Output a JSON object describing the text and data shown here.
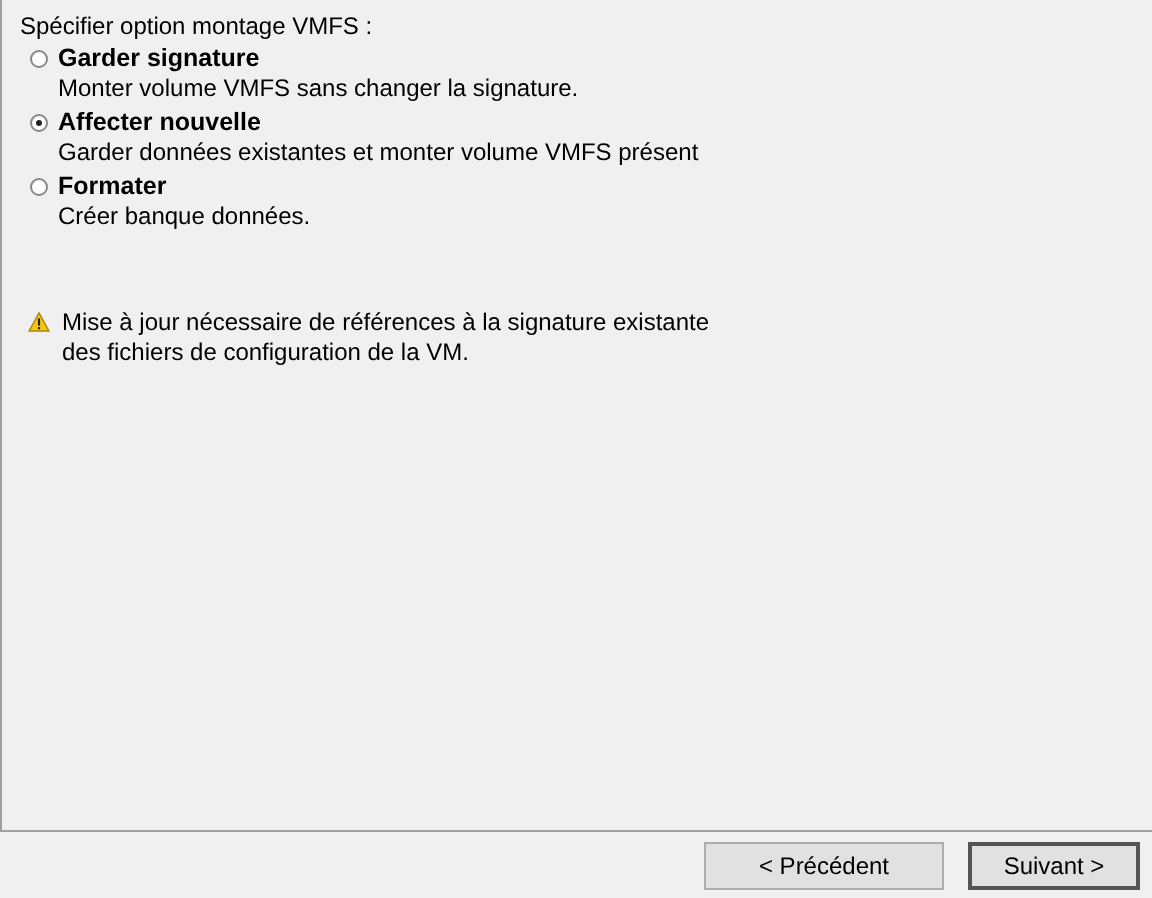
{
  "prompt": "Spécifier option montage VMFS :",
  "options": [
    {
      "label": "Garder signature",
      "description": "Monter volume VMFS sans changer la signature.",
      "selected": false
    },
    {
      "label": "Affecter nouvelle",
      "description": "Garder données existantes et monter volume VMFS présent",
      "selected": true
    },
    {
      "label": "Formater",
      "description": "Créer banque données.",
      "selected": false
    }
  ],
  "warning": {
    "lines": [
      "Mise à jour nécessaire de références à la signature existante",
      "des fichiers de configuration de la VM."
    ]
  },
  "buttons": [
    {
      "label": "< Précédent",
      "default": false
    },
    {
      "label": "Suivant >",
      "default": true
    }
  ]
}
